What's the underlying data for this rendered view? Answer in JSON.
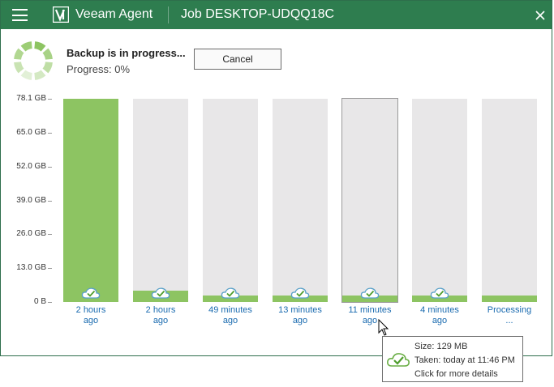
{
  "titlebar": {
    "menu_icon": "hamburger-menu-icon",
    "brand": "Veeam Agent",
    "job_title": "Job DESKTOP-UDQQ18C",
    "close_icon": "close-icon"
  },
  "status": {
    "title": "Backup is in progress...",
    "progress": "Progress: 0%",
    "progress_value": 0,
    "cancel_label": "Cancel"
  },
  "chart_data": {
    "type": "bar",
    "ylabel": "",
    "ylim": [
      0,
      78.1
    ],
    "yticks": [
      "78.1 GB",
      "65.0 GB",
      "52.0 GB",
      "39.0 GB",
      "26.0 GB",
      "13.0 GB",
      "0 B"
    ],
    "ytick_values": [
      78.1,
      65.0,
      52.0,
      39.0,
      26.0,
      13.0,
      0
    ],
    "categories": [
      "2 hours ago",
      "2 hours ago",
      "49 minutes ago",
      "13 minutes ago",
      "11 minutes ago",
      "4 minutes ago",
      "Processing ..."
    ],
    "label_lines": [
      [
        "2 hours",
        "ago"
      ],
      [
        "2 hours",
        "ago"
      ],
      [
        "49 minutes",
        "ago"
      ],
      [
        "13 minutes",
        "ago"
      ],
      [
        "11 minutes",
        "ago"
      ],
      [
        "4 minutes",
        "ago"
      ],
      [
        "Processing",
        "..."
      ]
    ],
    "values": [
      78.1,
      4.4,
      2.4,
      2.4,
      2.4,
      2.4,
      2.4
    ],
    "has_cloud_icon": [
      true,
      true,
      true,
      true,
      true,
      true,
      false
    ],
    "hover_index": 4,
    "colors": {
      "fill": "#8dc462",
      "slot": "#e8e7e8",
      "label": "#1a6bb0"
    }
  },
  "tooltip": {
    "icon": "cloud-check-icon",
    "size": "Size: 129 MB",
    "taken": "Taken: today at 11:46 PM",
    "hint": "Click for more details"
  },
  "colors": {
    "titlebar": "#2e7d4f",
    "accent_green": "#8dc462"
  }
}
